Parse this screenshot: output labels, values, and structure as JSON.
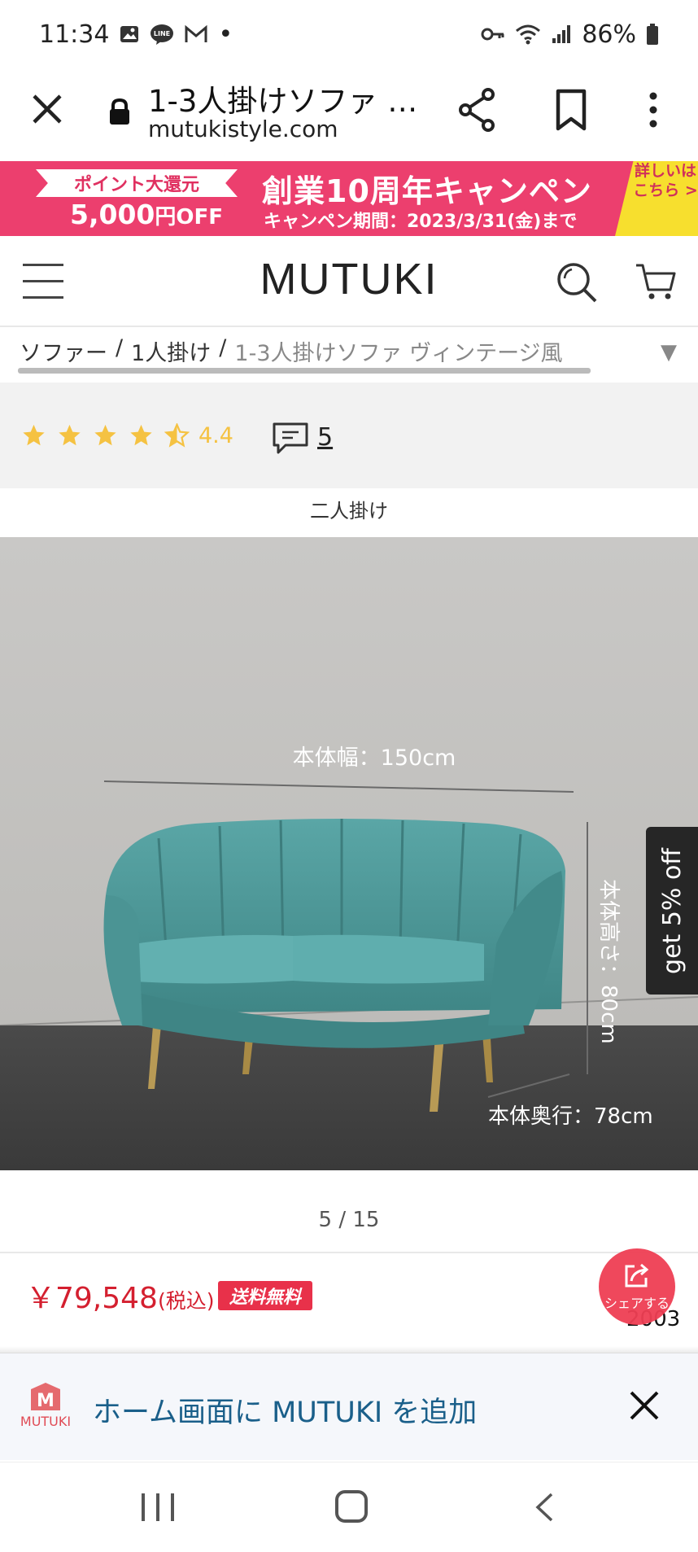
{
  "status_bar": {
    "time": "11:34",
    "dot": "•",
    "battery": "86%"
  },
  "browser": {
    "page_title": "1-3人掛けソファ …",
    "domain": "mutukistyle.com"
  },
  "banner": {
    "ribbon_text": "ポイント大還元",
    "off_amount": "5,000",
    "off_suffix": "円OFF",
    "title": "創業10周年キャンペン",
    "period": "キャンペン期間：2023/3/31(金)まで",
    "corner_text": "詳しいはこちら >"
  },
  "header": {
    "logo": "MUTUKI"
  },
  "breadcrumb": {
    "items": [
      "ソファー",
      "/",
      "1人掛け",
      "/",
      "1-3人掛けソファ ヴィンテージ風"
    ],
    "dropdown_arrow": "▼"
  },
  "rating": {
    "value": "4.4",
    "filled_stars": 4.5,
    "review_count": "5"
  },
  "variant_label": "二人掛け",
  "product_image": {
    "width_label": "本体幅：150cm",
    "height_label": "本体高さ：80cm",
    "depth_label": "本体奥行：78cm"
  },
  "side_tab": "get 5% off",
  "pagination": "5 / 15",
  "price": {
    "amount": "￥79,548",
    "tax_note": "(税込)",
    "shipping_badge": "送料無料"
  },
  "share_fab": {
    "label": "シェアする"
  },
  "partial_count": "2003",
  "add_to_home": {
    "logo_text": "MUTUKI",
    "message": "ホーム画面に MUTUKI を追加"
  },
  "colors": {
    "banner_pink": "#ec3f6e",
    "banner_yellow": "#f7df2e",
    "price_red": "#d41f2f",
    "star_yellow": "#f5c242",
    "sofa_teal": "#4e9a9a",
    "a2hs_text": "#1a5f8a"
  }
}
